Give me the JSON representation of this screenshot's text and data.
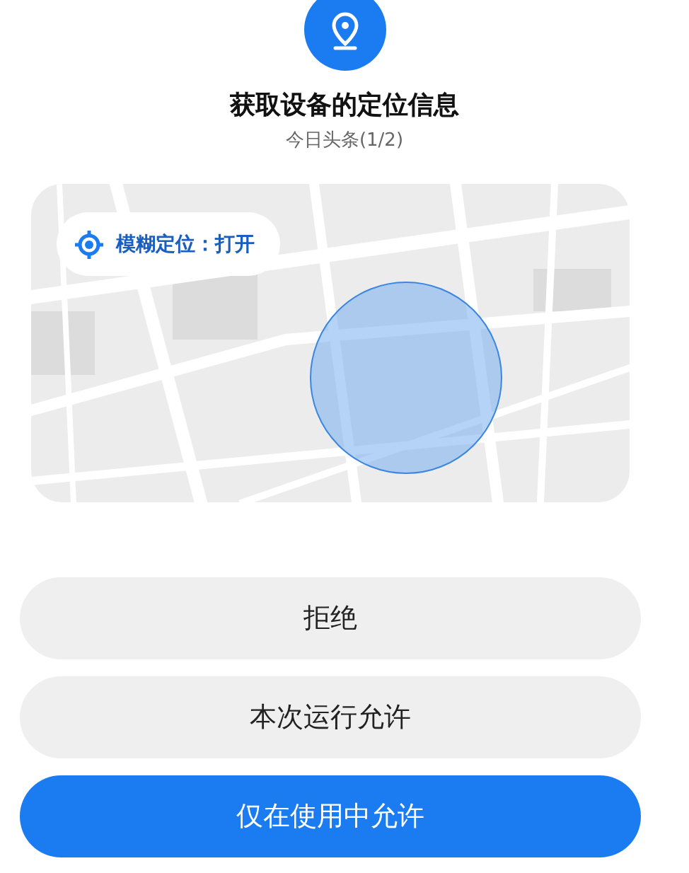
{
  "title": "获取设备的定位信息",
  "subtitle": "今日头条(1/2)",
  "map": {
    "kind": "picture",
    "chip": {
      "label": "模糊定位：打开"
    }
  },
  "buttons": [
    {
      "label": "拒绝",
      "kind": "secondary"
    },
    {
      "label": "本次运行允许",
      "kind": "secondary"
    },
    {
      "label": "仅在使用中允许",
      "kind": "primary"
    }
  ]
}
